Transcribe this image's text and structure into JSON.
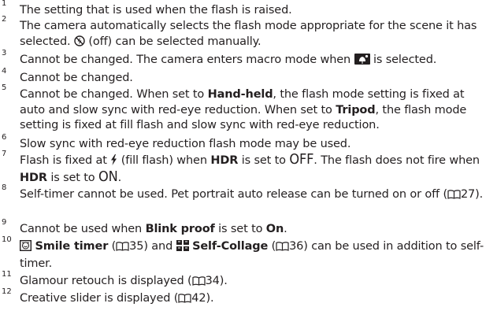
{
  "notes": [
    {
      "n": "1",
      "text": "The setting that is used when the flash is raised."
    },
    {
      "n": "2",
      "a": "The camera automatically selects the flash mode appropriate for the scene it has selected.",
      "b": "(off) can be selected manually."
    },
    {
      "n": "3",
      "a": "Cannot be changed. The camera enters macro mode when",
      "b": "is selected."
    },
    {
      "n": "4",
      "text": "Cannot be changed."
    },
    {
      "n": "5",
      "a": "Cannot be changed. When set to",
      "b1": "Hand-held",
      "c": ", the flash mode setting is fixed at auto and slow sync with red-eye reduction. When set to",
      "b2": "Tripod",
      "d": ", the flash mode setting is fixed at fill flash and slow sync with red-eye reduction."
    },
    {
      "n": "6",
      "text": "Slow sync with red-eye reduction flash mode may be used."
    },
    {
      "n": "7",
      "a": "Flash is fixed at",
      "b": "(fill flash) when",
      "hdr": "HDR",
      "c": "is set to",
      "off": "OFF",
      "d": ". The flash does not fire when",
      "e": "is set to",
      "on": "ON",
      "f": "."
    },
    {
      "n": "8",
      "a": "Self-timer cannot be used. Pet portrait auto release can be turned on or off (",
      "ref": "27",
      "b": ")."
    },
    {
      "n": "9",
      "a": "Cannot be used when",
      "b1": "Blink proof",
      "c": "is set to",
      "b2": "On",
      "d": "."
    },
    {
      "n": "10",
      "b1": "Smile timer",
      "ref1": "35",
      "b2": "Self-Collage",
      "ref2": "36",
      "a": "can be used in addition to self-timer."
    },
    {
      "n": "11",
      "a": "Glamour retouch is displayed (",
      "ref": "34",
      "b": ")."
    },
    {
      "n": "12",
      "a": "Creative slider is displayed (",
      "ref": "42",
      "b": ")."
    }
  ],
  "icons": [
    "flash-off-icon",
    "scene-close-up-icon",
    "fill-flash-icon",
    "smile-timer-icon",
    "self-collage-icon",
    "book-reference-icon"
  ]
}
